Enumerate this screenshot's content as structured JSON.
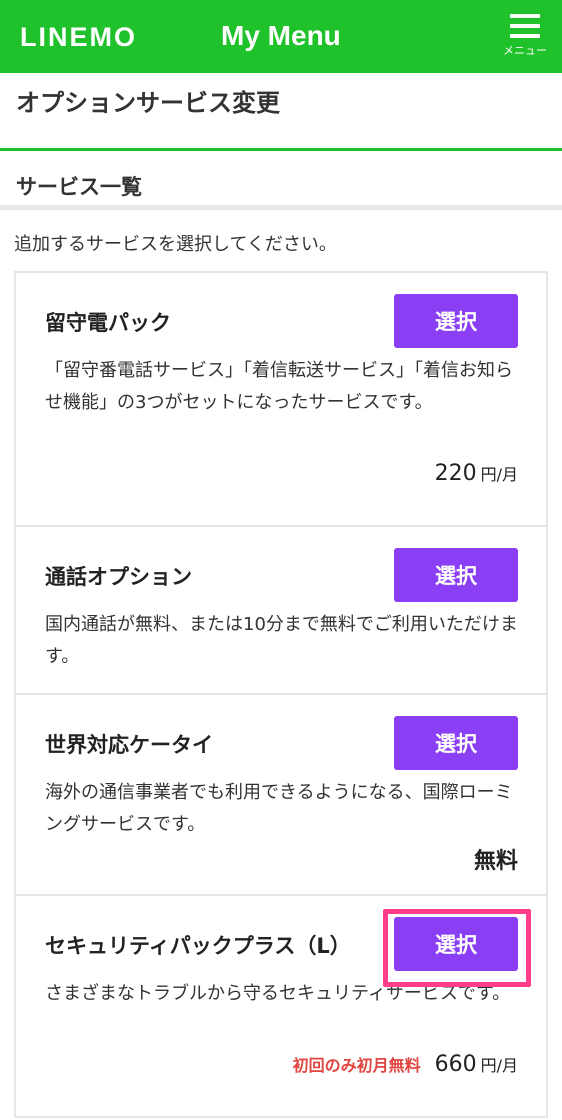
{
  "header": {
    "logo": "LINEMO",
    "title": "My Menu",
    "menu_label": "メニュー"
  },
  "page_title": "オプションサービス変更",
  "section_title": "サービス一覧",
  "intro": "追加するサービスを選択してください。",
  "services": [
    {
      "name": "留守電パック",
      "button": "選択",
      "desc": "「留守番電話サービス」「着信転送サービス」「着信お知らせ機能」の3つがセットになったサービスです。",
      "price": "220",
      "unit": "円/月"
    },
    {
      "name": "通話オプション",
      "button": "選択",
      "desc": "国内通話が無料、または10分まで無料でご利用いただけます。"
    },
    {
      "name": "世界対応ケータイ",
      "button": "選択",
      "desc": "海外の通信事業者でも利用できるようになる、国際ローミングサービスです。",
      "price_label": "無料"
    },
    {
      "name": "セキュリティパックプラス（L）",
      "button": "選択",
      "desc": "さまざまなトラブルから守るセキュリティサービスです。",
      "promo": "初回のみ初月無料",
      "price": "660",
      "unit": "円/月"
    }
  ],
  "colors": {
    "brand_green": "#20c22b",
    "button_purple": "#8a3ff5",
    "promo_red": "#e0453f",
    "highlight_pink": "#ff3d8a"
  }
}
